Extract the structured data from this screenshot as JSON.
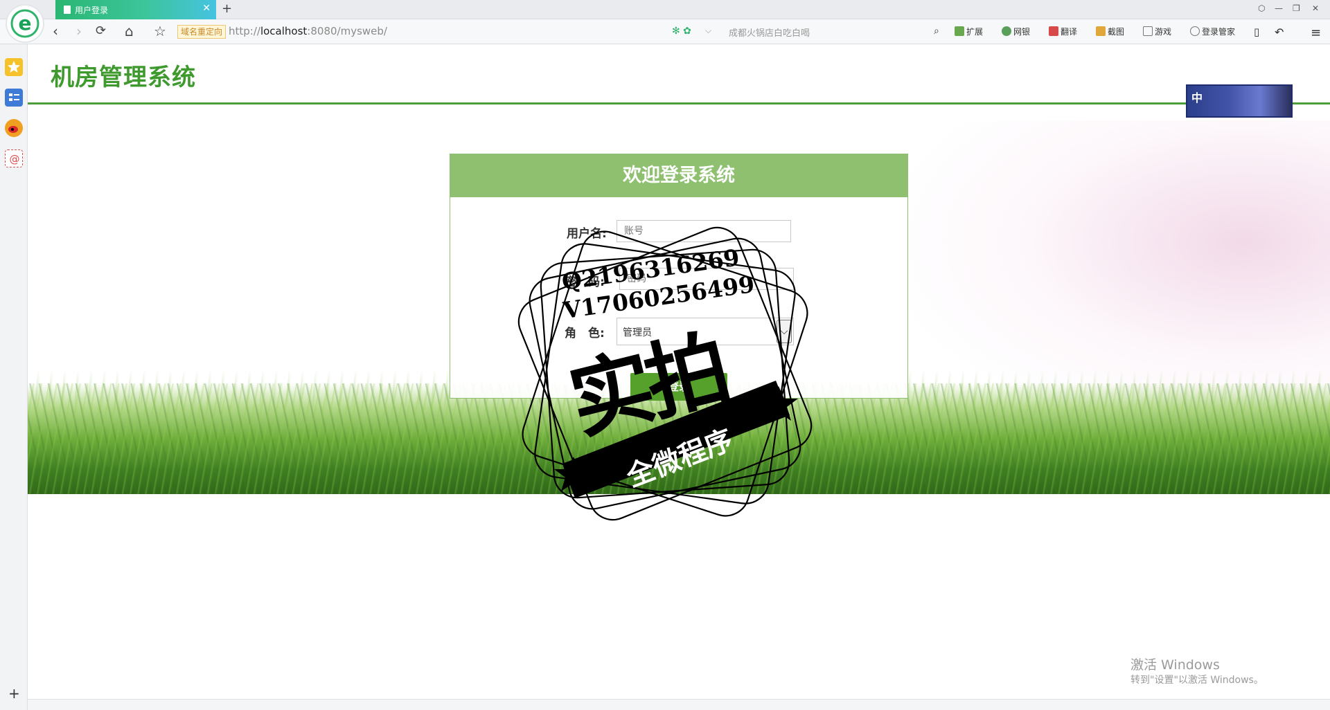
{
  "browser": {
    "tab_title": "用户登录",
    "tab_close": "✕",
    "new_tab": "+",
    "redirect_badge": "域名重定向",
    "url_prefix": "http://",
    "url_host": "localhost",
    "url_rest": ":8080/mysweb/",
    "search_placeholder": "成都火锅店白吃白喝",
    "tools": {
      "extend": "扩展",
      "bank": "网银",
      "translate": "翻译",
      "screenshot": "截图",
      "games": "游戏",
      "login_manager": "登录管家"
    },
    "window_controls": {
      "skin": "⬡",
      "min": "—",
      "restore": "❐",
      "close": "✕"
    },
    "nav": {
      "back": "‹",
      "forward": "›",
      "reload": "⟳",
      "home": "⌂",
      "favorite": "☆",
      "undo": "↶",
      "menu": "≡"
    }
  },
  "page": {
    "system_title": "机房管理系统",
    "ime_label": "中",
    "login": {
      "heading": "欢迎登录系统",
      "username_label": "用户名:",
      "username_placeholder": "账号",
      "password_label": "密　码:",
      "password_placeholder": "密码",
      "role_label": "角　色:",
      "role_selected": "管理员",
      "submit_label": "登录"
    }
  },
  "watermark": {
    "line1": "Q2196316269",
    "line2": "V17060256499",
    "big": "实拍",
    "banner": "全微程序"
  },
  "os_notice": {
    "title": "激活 Windows",
    "subtitle": "转到\"设置\"以激活 Windows。"
  },
  "sidebar_plus": "+"
}
